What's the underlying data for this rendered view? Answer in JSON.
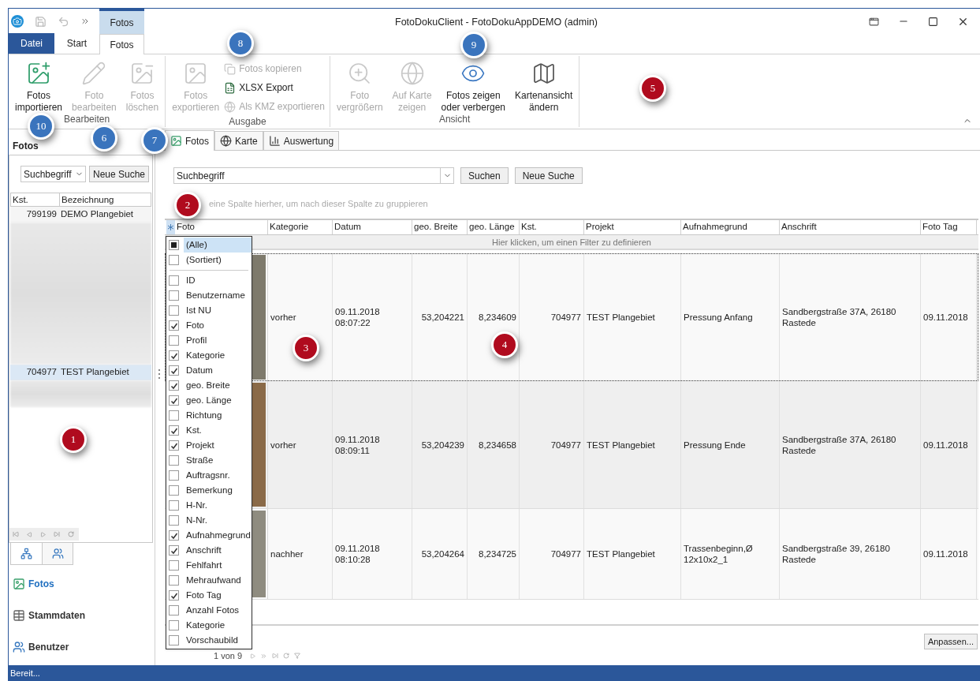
{
  "window": {
    "title": "FotoDokuClient - FotoDokuAppDEMO (admin)",
    "context_tab": "Fotos"
  },
  "ribbon_tabs": [
    {
      "label": "Datei",
      "kind": "file",
      "selected": false
    },
    {
      "label": "Start",
      "kind": "tab",
      "selected": false
    },
    {
      "label": "Fotos",
      "kind": "tab",
      "selected": true
    }
  ],
  "ribbon_groups": [
    {
      "label": "Bearbeiten",
      "items": [
        {
          "label": "Fotos\nimportieren",
          "kind": "large",
          "disabled": false
        },
        {
          "label": "Foto\nbearbeiten",
          "kind": "large",
          "disabled": true
        },
        {
          "label": "Fotos\nlöschen",
          "kind": "large",
          "disabled": true
        }
      ]
    },
    {
      "label": "Ausgabe",
      "items": [
        {
          "label": "Fotos\nexportieren",
          "kind": "large",
          "disabled": true
        },
        {
          "label": "Fotos kopieren",
          "kind": "small",
          "disabled": true
        },
        {
          "label": "XLSX Export",
          "kind": "small",
          "disabled": false
        },
        {
          "label": "Als KMZ exportieren",
          "kind": "small",
          "disabled": true
        }
      ]
    },
    {
      "label": "Ansicht",
      "items": [
        {
          "label": "Foto\nvergrößern",
          "kind": "large",
          "disabled": true
        },
        {
          "label": "Auf Karte\nzeigen",
          "kind": "large",
          "disabled": true
        },
        {
          "label": "Fotos zeigen\noder verbergen",
          "kind": "large",
          "disabled": false
        },
        {
          "label": "Kartenansicht\nändern",
          "kind": "large",
          "disabled": false
        }
      ]
    }
  ],
  "side_panel": {
    "title": "Fotos",
    "search_value": "Suchbegriff",
    "search_button": "Neue Suche",
    "columns": [
      "Kst.",
      "Bezeichnung"
    ],
    "rows": [
      {
        "kind": "row",
        "kst": "799199",
        "name": "DEMO Plangebiet",
        "selected": false
      },
      {
        "kind": "blurred",
        "selected": false
      },
      {
        "kind": "row",
        "kst": "704977",
        "name": "TEST Plangebiet",
        "selected": true
      },
      {
        "kind": "blurred",
        "selected": false
      }
    ]
  },
  "nav_icon_tabs": [
    {
      "selected": true
    },
    {
      "selected": false
    }
  ],
  "nav_items": [
    {
      "label": "Fotos",
      "selected": true
    },
    {
      "label": "Stammdaten",
      "selected": false
    },
    {
      "label": "Benutzer",
      "selected": false
    }
  ],
  "content_tabs": [
    {
      "label": "Fotos",
      "selected": true
    },
    {
      "label": "Karte",
      "selected": false
    },
    {
      "label": "Auswertung",
      "selected": false
    }
  ],
  "search": {
    "value": "Suchbegriff",
    "buttons": [
      "Suchen",
      "Neue Suche"
    ]
  },
  "group_hint": "eine Spalte hierher, um nach dieser Spalte zu gruppieren",
  "table": {
    "columns": [
      "Foto",
      "Kategorie",
      "Datum",
      "geo. Breite",
      "geo. Länge",
      "Kst.",
      "Projekt",
      "Aufnahmegrund",
      "Anschrift",
      "Foto Tag"
    ],
    "filter_hint": "Hier klicken, um einen Filter zu definieren",
    "rows": [
      {
        "selected": true,
        "cells": [
          "",
          "vorher",
          "09.11.2018\n08:07:22",
          "53,204221",
          "8,234609",
          "704977",
          "TEST Plangebiet",
          "Pressung Anfang",
          "Sandbergstraße 37A, 26180\nRastede",
          "09.11.2018"
        ]
      },
      {
        "selected": false,
        "cells": [
          "",
          "vorher",
          "09.11.2018\n08:09:11",
          "53,204239",
          "8,234658",
          "704977",
          "TEST Plangebiet",
          "Pressung Ende",
          "Sandbergstraße 37A, 26180\nRastede",
          "09.11.2018"
        ]
      },
      {
        "selected": false,
        "cells": [
          "",
          "nachher",
          "09.11.2018\n08:10:28",
          "53,204264",
          "8,234725",
          "704977",
          "TEST Plangebiet",
          "Trassenbeginn,Ø\n12x10x2_1",
          "Sandbergstraße 39, 26180\nRastede",
          "09.11.2018"
        ]
      }
    ]
  },
  "column_chooser": {
    "special": [
      {
        "label": "(Alle)",
        "checked": true,
        "selected": true
      },
      {
        "label": "(Sortiert)",
        "checked": false,
        "selected": false
      }
    ],
    "items": [
      {
        "label": "ID",
        "checked": false
      },
      {
        "label": "Benutzername",
        "checked": false
      },
      {
        "label": "Ist NU",
        "checked": false
      },
      {
        "label": "Foto",
        "checked": true
      },
      {
        "label": "Profil",
        "checked": false
      },
      {
        "label": "Kategorie",
        "checked": true
      },
      {
        "label": "Datum",
        "checked": true
      },
      {
        "label": "geo. Breite",
        "checked": true
      },
      {
        "label": "geo. Länge",
        "checked": true
      },
      {
        "label": "Richtung",
        "checked": false
      },
      {
        "label": "Kst.",
        "checked": true
      },
      {
        "label": "Projekt",
        "checked": true
      },
      {
        "label": "Straße",
        "checked": false
      },
      {
        "label": "Auftragsnr.",
        "checked": false
      },
      {
        "label": "Bemerkung",
        "checked": false
      },
      {
        "label": "H-Nr.",
        "checked": false
      },
      {
        "label": "N-Nr.",
        "checked": false
      },
      {
        "label": "Aufnahmegrund",
        "checked": true
      },
      {
        "label": "Anschrift",
        "checked": true
      },
      {
        "label": "Fehlfahrt",
        "checked": false
      },
      {
        "label": "Mehraufwand",
        "checked": false
      },
      {
        "label": "Foto Tag",
        "checked": true
      },
      {
        "label": "Anzahl Fotos",
        "checked": false
      },
      {
        "label": "Kategorie",
        "checked": false
      },
      {
        "label": "Vorschaubild",
        "checked": false
      }
    ]
  },
  "pager": {
    "text": "1 von 9"
  },
  "customize_button": "Anpassen...",
  "status_bar": "Bereit...",
  "callouts": [
    {
      "label": "8",
      "color": "#3a74bd"
    },
    {
      "label": "9",
      "color": "#3a74bd"
    },
    {
      "label": "5",
      "color": "#b00b1e"
    },
    {
      "label": "10",
      "color": "#3a74bd"
    },
    {
      "label": "6",
      "color": "#3a74bd"
    },
    {
      "label": "7",
      "color": "#3a74bd"
    },
    {
      "label": "2",
      "color": "#b00b1e"
    },
    {
      "label": "3",
      "color": "#b00b1e"
    },
    {
      "label": "4",
      "color": "#b00b1e"
    },
    {
      "label": "1",
      "color": "#b00b1e"
    }
  ]
}
